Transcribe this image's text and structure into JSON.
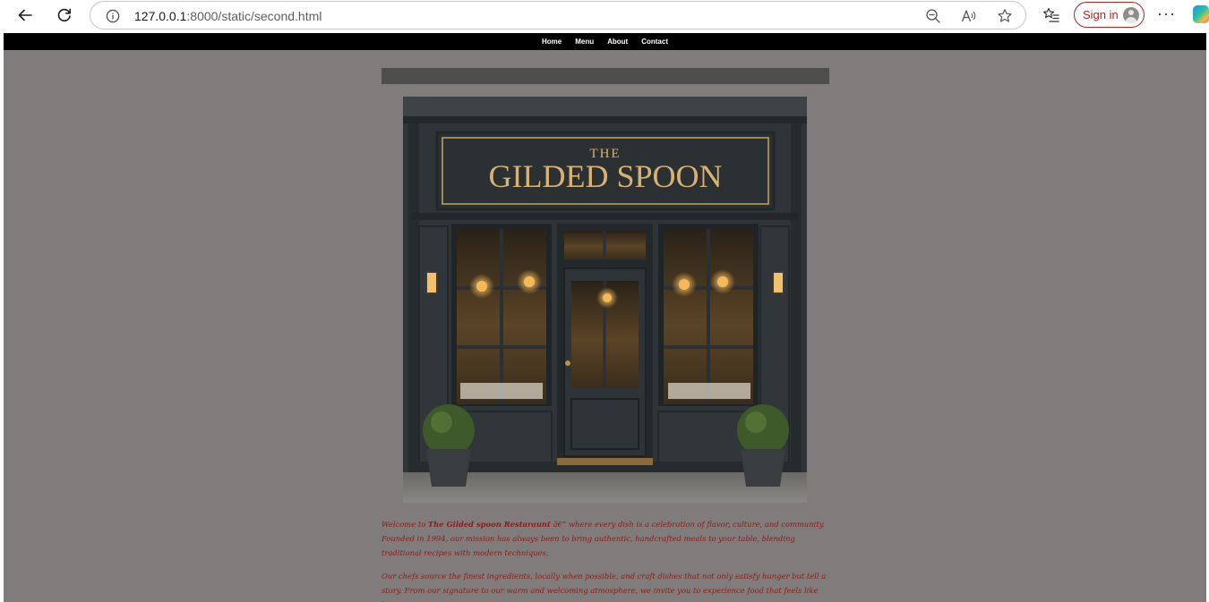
{
  "browser": {
    "url_host": "127.0.0.1",
    "url_path": ":8000/static/second.html",
    "signin_label": "Sign in"
  },
  "site": {
    "nav": [
      {
        "label": "Home"
      },
      {
        "label": "Menu"
      },
      {
        "label": "About"
      },
      {
        "label": "Contact"
      }
    ],
    "hero_sign": {
      "line1": "THE",
      "line2": "GILDED SPOON"
    },
    "intro": {
      "prefix": "Welcome to ",
      "name": "The Gilded spoon Restaraunt",
      "suffix": " â€” where every dish is a celebration of flavor, culture, and community. Founded in 1994, our mission has always been to bring authentic, handcrafted meals to your table, blending traditional recipes with modern techniques."
    },
    "second_paragraph": "Our chefs source the finest ingredients, locally when possible, and craft dishes that not only satisfy hunger but tell a story. From our signature to our warm and welcoming atmosphere, we invite you to experience food that feels like home."
  },
  "colors": {
    "page_background": "#807c7b",
    "nav_background": "#000000",
    "text_accent": "#8e1b1b",
    "signin_accent": "#b3261e",
    "sign_gold": "#c9a463"
  }
}
